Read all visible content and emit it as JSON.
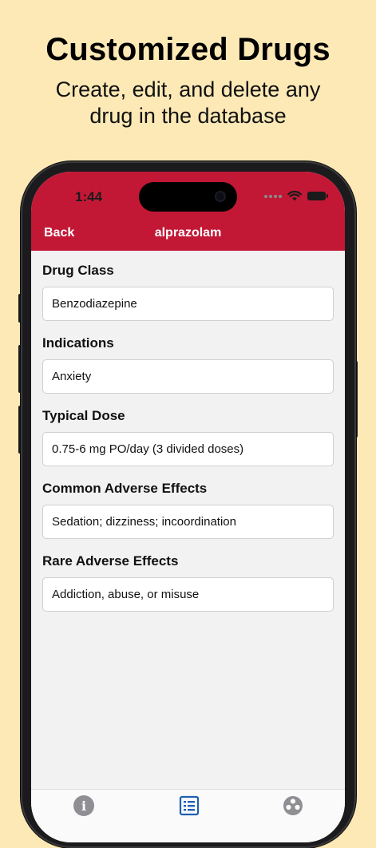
{
  "promo": {
    "headline": "Customized Drugs",
    "subline": "Create, edit, and delete any drug in the database"
  },
  "status_bar": {
    "time": "1:44"
  },
  "nav": {
    "back_label": "Back",
    "title": "alprazolam"
  },
  "fields": [
    {
      "label": "Drug Class",
      "value": "Benzodiazepine"
    },
    {
      "label": "Indications",
      "value": "Anxiety"
    },
    {
      "label": "Typical Dose",
      "value": "0.75-6 mg PO/day (3 divided doses)"
    },
    {
      "label": "Common Adverse Effects",
      "value": "Sedation; dizziness; incoordination"
    },
    {
      "label": "Rare Adverse Effects",
      "value": "Addiction, abuse, or misuse"
    }
  ],
  "tab_bar": {
    "items": [
      {
        "icon": "info-icon",
        "selected": false
      },
      {
        "icon": "list-icon",
        "selected": true
      },
      {
        "icon": "people-icon",
        "selected": false
      }
    ]
  },
  "colors": {
    "background": "#fde9b6",
    "header": "#c21836",
    "selected_tab": "#1e5fb4",
    "unselected_tab": "#8e8e93"
  }
}
